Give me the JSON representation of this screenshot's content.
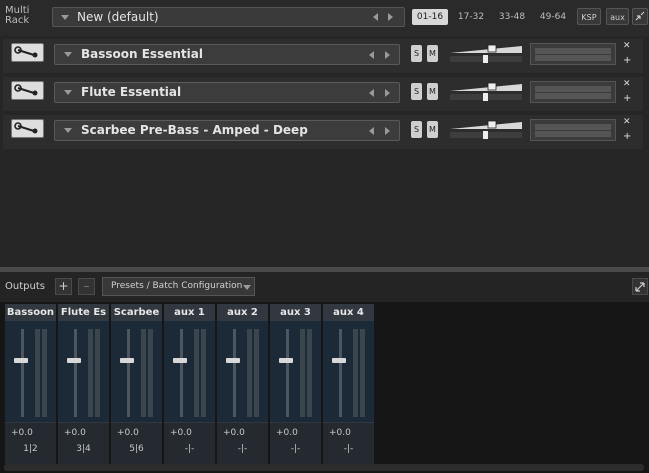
{
  "header": {
    "label": "Multi Rack",
    "preset_name": "New (default)",
    "page_tabs": [
      "01-16",
      "17-32",
      "33-48",
      "49-64"
    ],
    "ksp_label": "KSP",
    "aux_label": "aux"
  },
  "rack": {
    "instruments": [
      {
        "name": "Bassoon Essential",
        "solo": "S",
        "mute": "M"
      },
      {
        "name": "Flute Essential",
        "solo": "S",
        "mute": "M"
      },
      {
        "name": "Scarbee Pre-Bass - Amped - Deep",
        "solo": "S",
        "mute": "M"
      }
    ]
  },
  "outputs": {
    "label": "Outputs",
    "add_label": "+",
    "remove_label": "–",
    "presets_label": "Presets / Batch Configuration",
    "channels": [
      {
        "name": "Bassoon",
        "volume": "+0.0",
        "route": "1|2"
      },
      {
        "name": "Flute Es",
        "volume": "+0.0",
        "route": "3|4"
      },
      {
        "name": "Scarbee",
        "volume": "+0.0",
        "route": "5|6"
      },
      {
        "name": "aux 1",
        "volume": "+0.0",
        "route": "-|-"
      },
      {
        "name": "aux 2",
        "volume": "+0.0",
        "route": "-|-"
      },
      {
        "name": "aux 3",
        "volume": "+0.0",
        "route": "-|-"
      },
      {
        "name": "aux 4",
        "volume": "+0.0",
        "route": "-|-"
      }
    ]
  },
  "colors": {
    "background": "#141414",
    "panel": "#262626",
    "strip_fader_bg": "#1b2a36",
    "active_tab": "#d8d8d8"
  }
}
